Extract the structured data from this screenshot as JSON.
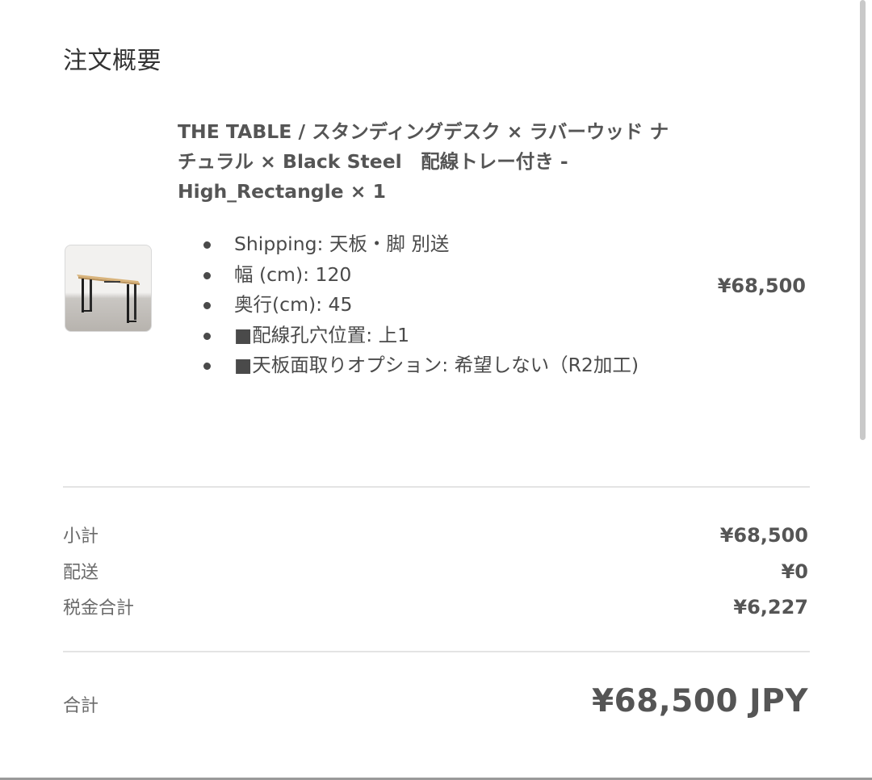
{
  "summary": {
    "heading": "注文概要"
  },
  "item": {
    "title": "THE TABLE / スタンディングデスク × ラバーウッド ナチュラル × Black Steel　配線トレー付き - High_Rectangle × 1",
    "thumbnail_icon": "standing-desk-product-image",
    "price": "¥68,500",
    "options": [
      "Shipping: 天板・脚 別送",
      "幅 (cm): 120",
      "奥行(cm): 45",
      "■配線孔穴位置: 上1",
      "■天板面取りオプション: 希望しない（R2加工)"
    ]
  },
  "totals": {
    "subtotal_label": "小計",
    "subtotal_value": "¥68,500",
    "shipping_label": "配送",
    "shipping_value": "¥0",
    "tax_label": "税金合計",
    "tax_value": "¥6,227",
    "total_label": "合計",
    "total_value": "¥68,500 JPY"
  }
}
